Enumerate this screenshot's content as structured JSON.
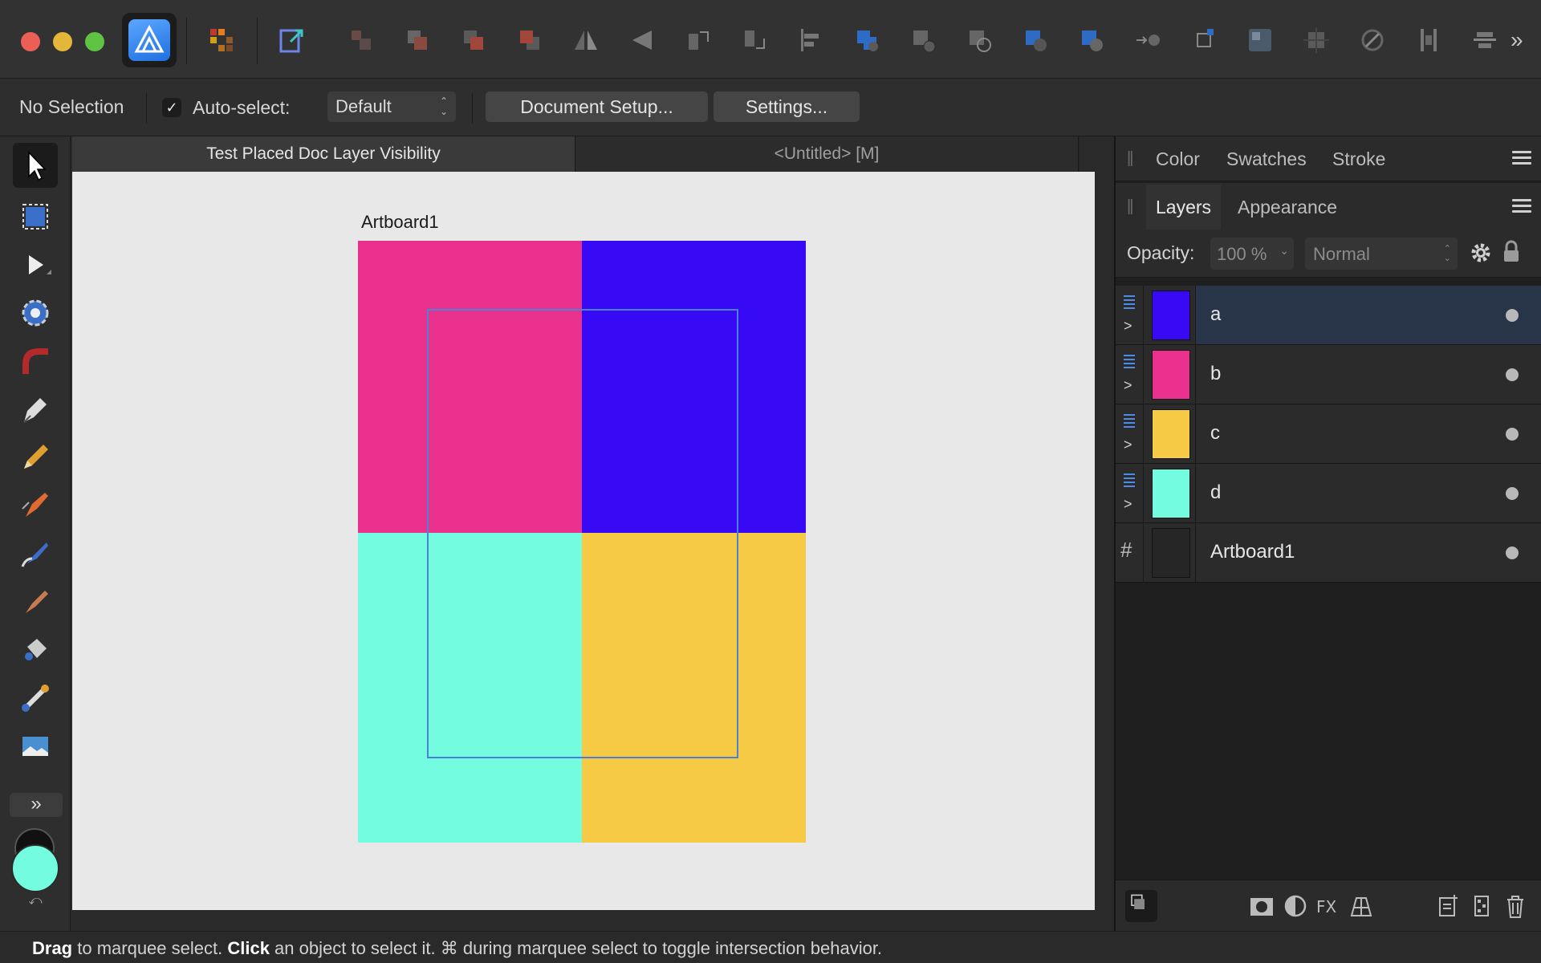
{
  "toolbar": {
    "icons": [
      "persona-designer-icon",
      "place-image-icon",
      "export-persona-icon",
      "group-icon",
      "ungroup-icon",
      "bring-front-icon",
      "send-back-icon",
      "flip-h-icon",
      "flip-v-icon",
      "rotate-left-icon",
      "rotate-right-icon",
      "align-icon",
      "boolean-add-icon",
      "boolean-subtract-icon",
      "boolean-intersect-icon",
      "boolean-xor-icon",
      "boolean-divide-icon",
      "snap-icon",
      "transform-icon",
      "grid-icon",
      "constraints-icon",
      "geometry-icon",
      "distribute-icon",
      "more-icon"
    ],
    "more_glyph": "»"
  },
  "context": {
    "selection": "No Selection",
    "auto_select_checked": "✓",
    "auto_select_label": "Auto-select:",
    "auto_select_value": "Default",
    "document_setup": "Document Setup...",
    "settings": "Settings..."
  },
  "doc_tabs": [
    {
      "label": "Test Placed Doc Layer Visibility",
      "active": true
    },
    {
      "label": "<Untitled> [M]",
      "active": false
    }
  ],
  "canvas": {
    "artboard_label": "Artboard1",
    "colors": {
      "a": "#3709f5",
      "b": "#ea308d",
      "c": "#f6ca44",
      "d": "#74fce0"
    }
  },
  "tools": {
    "more_glyph": "»",
    "fill_color": "#74fce0",
    "stroke_color": "#111111",
    "swap_glyph": "⤺"
  },
  "panels": {
    "top_tabs": [
      "Color",
      "Swatches",
      "Stroke"
    ],
    "layer_tabs": [
      "Layers",
      "Appearance"
    ],
    "opacity_label": "Opacity:",
    "opacity_value": "100 %",
    "opacity_arrow": "⌄",
    "blend_mode": "Normal",
    "layers": [
      {
        "name": "a",
        "color": "#3709f5",
        "selected": true
      },
      {
        "name": "b",
        "color": "#ea308d",
        "selected": false
      },
      {
        "name": "c",
        "color": "#f6ca44",
        "selected": false
      },
      {
        "name": "d",
        "color": "#74fce0",
        "selected": false
      },
      {
        "name": "Artboard1",
        "color": "#262626",
        "selected": false
      }
    ],
    "chevron_glyph": ">",
    "artboard_glyph": "#"
  },
  "status": {
    "drag": "Drag",
    "drag_rest": " to marquee select. ",
    "click": "Click",
    "click_rest": " an object to select it. ⌘ during marquee select to toggle intersection behavior."
  }
}
